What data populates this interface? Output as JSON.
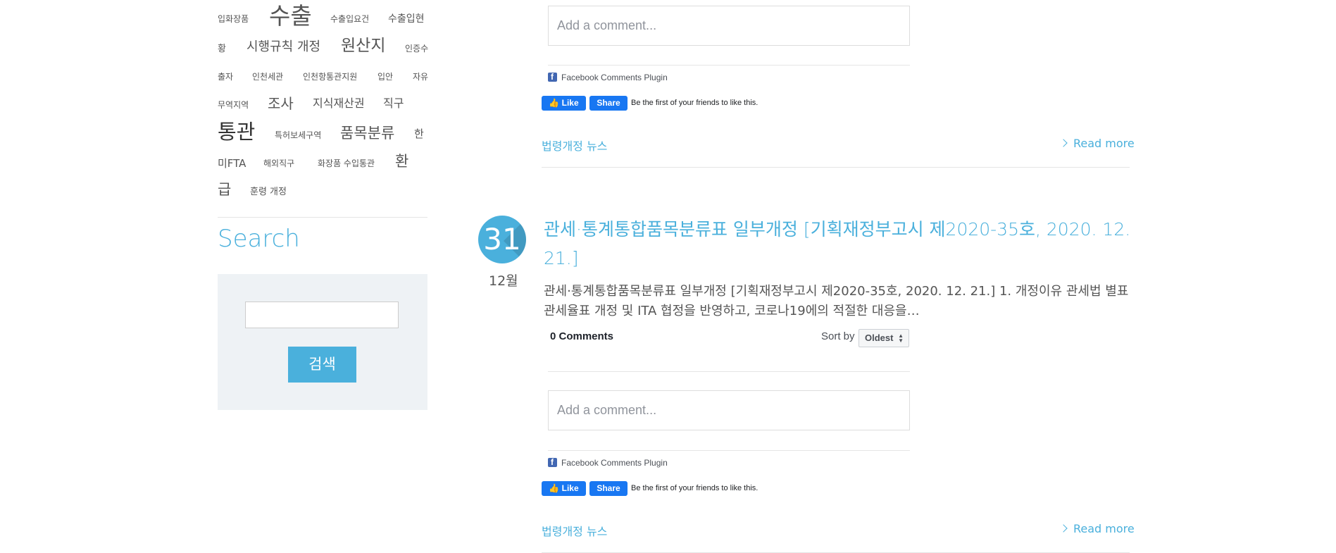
{
  "tag_cloud": {
    "tags": [
      "입화장품",
      "수출",
      "수출입요건",
      "수출입현",
      "황",
      "시행규칙 개정",
      "원산지",
      "인증수",
      "출자",
      "인천세관",
      "인천항통관지원",
      "입안",
      "자유",
      "무역지역",
      "조사",
      "지식재산권",
      "직구",
      "통관",
      "특허보세구역",
      "품목분류",
      "한",
      "미FTA",
      "해외직구",
      "화장품 수입통관",
      "환",
      "급",
      "훈령 개정"
    ]
  },
  "search": {
    "title": "Search",
    "input_value": "",
    "button_label": "검색"
  },
  "posts": [
    {
      "comment_placeholder": "Add a comment...",
      "fb_plugin_label": "Facebook Comments Plugin",
      "like_label": "Like",
      "share_label": "Share",
      "social_text": "Be the first of your friends to like this.",
      "category": "법령개정 뉴스",
      "read_more": "Read more"
    },
    {
      "day": "31",
      "month": "12월",
      "title": "관세·통계통합품목분류표 일부개정 [기획재정부고시 제2020-35호, 2020. 12. 21.]",
      "excerpt": "관세·통계통합품목분류표 일부개정 [기획재정부고시 제2020-35호, 2020. 12. 21.] 1. 개정이유 관세법 별표 관세율표 개정 및 ITA 협정을 반영하고, 코로나19에의 적절한 대응을…",
      "comments_count": "0 Comments",
      "sort_label": "Sort by",
      "sort_value": "Oldest",
      "comment_placeholder": "Add a comment...",
      "fb_plugin_label": "Facebook Comments Plugin",
      "like_label": "Like",
      "share_label": "Share",
      "social_text": "Be the first of your friends to like this.",
      "category": "법령개정 뉴스",
      "read_more": "Read more"
    }
  ],
  "colors": {
    "accent": "#4ab0dc",
    "facebook_blue": "#1877f2",
    "search_panel_bg": "#eef2f5"
  }
}
